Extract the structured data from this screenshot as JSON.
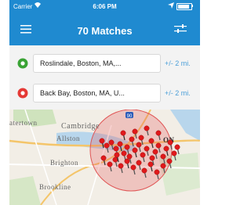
{
  "status_bar": {
    "carrier": "Carrier",
    "time": "6:06 PM"
  },
  "header": {
    "title": "70 Matches",
    "menu_icon": "hamburger-menu-icon",
    "filter_icon": "sliders-filter-icon"
  },
  "locations": [
    {
      "address": "Roslindale, Boston, MA,...",
      "radius": "+/- 2 mi.",
      "marker": "green-circle-icon",
      "color": "#3aa335"
    },
    {
      "address": "Back Bay, Boston, MA, U...",
      "radius": "+/- 2 mi.",
      "marker": "red-circle-icon",
      "color": "#e53935"
    }
  ],
  "map": {
    "labels": [
      "atertown",
      "Cambridge",
      "Allston",
      "Brighton",
      "Brookline",
      "ON"
    ],
    "highway_shield": "90"
  },
  "colors": {
    "header": "#1f8ad0",
    "accent": "#4a9ed8",
    "marker_red": "#e0191b"
  }
}
